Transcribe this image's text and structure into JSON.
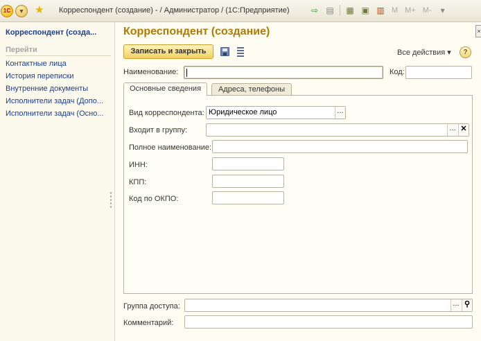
{
  "titlebar": {
    "title": "Корреспондент (создание) - / Администратор /  (1С:Предприятие)",
    "logo_text": "1С",
    "menu_icon": "chevron-down-icon",
    "favorite_icon": "star-icon",
    "toolbar_icons": [
      "back-icon",
      "forward-icon",
      "spreadsheet-icon",
      "calculator-icon",
      "calendar-icon"
    ],
    "m_labels": [
      "M",
      "M+",
      "M-"
    ]
  },
  "sidebar": {
    "title": "Корреспондент (созда...",
    "section_title": "Перейти",
    "items": [
      {
        "label": "Контактные лица"
      },
      {
        "label": "История переписки"
      },
      {
        "label": "Внутренние документы"
      },
      {
        "label": "Исполнители задач (Допо..."
      },
      {
        "label": "Исполнители задач (Осно..."
      }
    ]
  },
  "form": {
    "title": "Корреспондент (создание)",
    "save_close_label": "Записать и закрыть",
    "all_actions_label": "Все действия ▾",
    "help_label": "?",
    "name_label": "Наименование:",
    "name_value": "",
    "code_label": "Код:",
    "code_value": "",
    "tabs": [
      {
        "label": "Основные сведения",
        "active": true
      },
      {
        "label": "Адреса, телефоны",
        "active": false
      }
    ],
    "fields": {
      "kind_label": "Вид корреспондента:",
      "kind_value": "Юридическое лицо",
      "group_label": "Входит в группу:",
      "group_value": "",
      "fullname_label": "Полное наименование:",
      "fullname_value": "",
      "inn_label": "ИНН:",
      "inn_value": "",
      "kpp_label": "КПП:",
      "kpp_value": "",
      "okpo_label": "Код по ОКПО:",
      "okpo_value": ""
    },
    "access_group_label": "Группа доступа:",
    "access_group_value": "",
    "comment_label": "Комментарий:",
    "comment_value": "",
    "select_button_glyph": "...",
    "clear_button_glyph": "✕",
    "search_button_glyph": "⚲"
  }
}
